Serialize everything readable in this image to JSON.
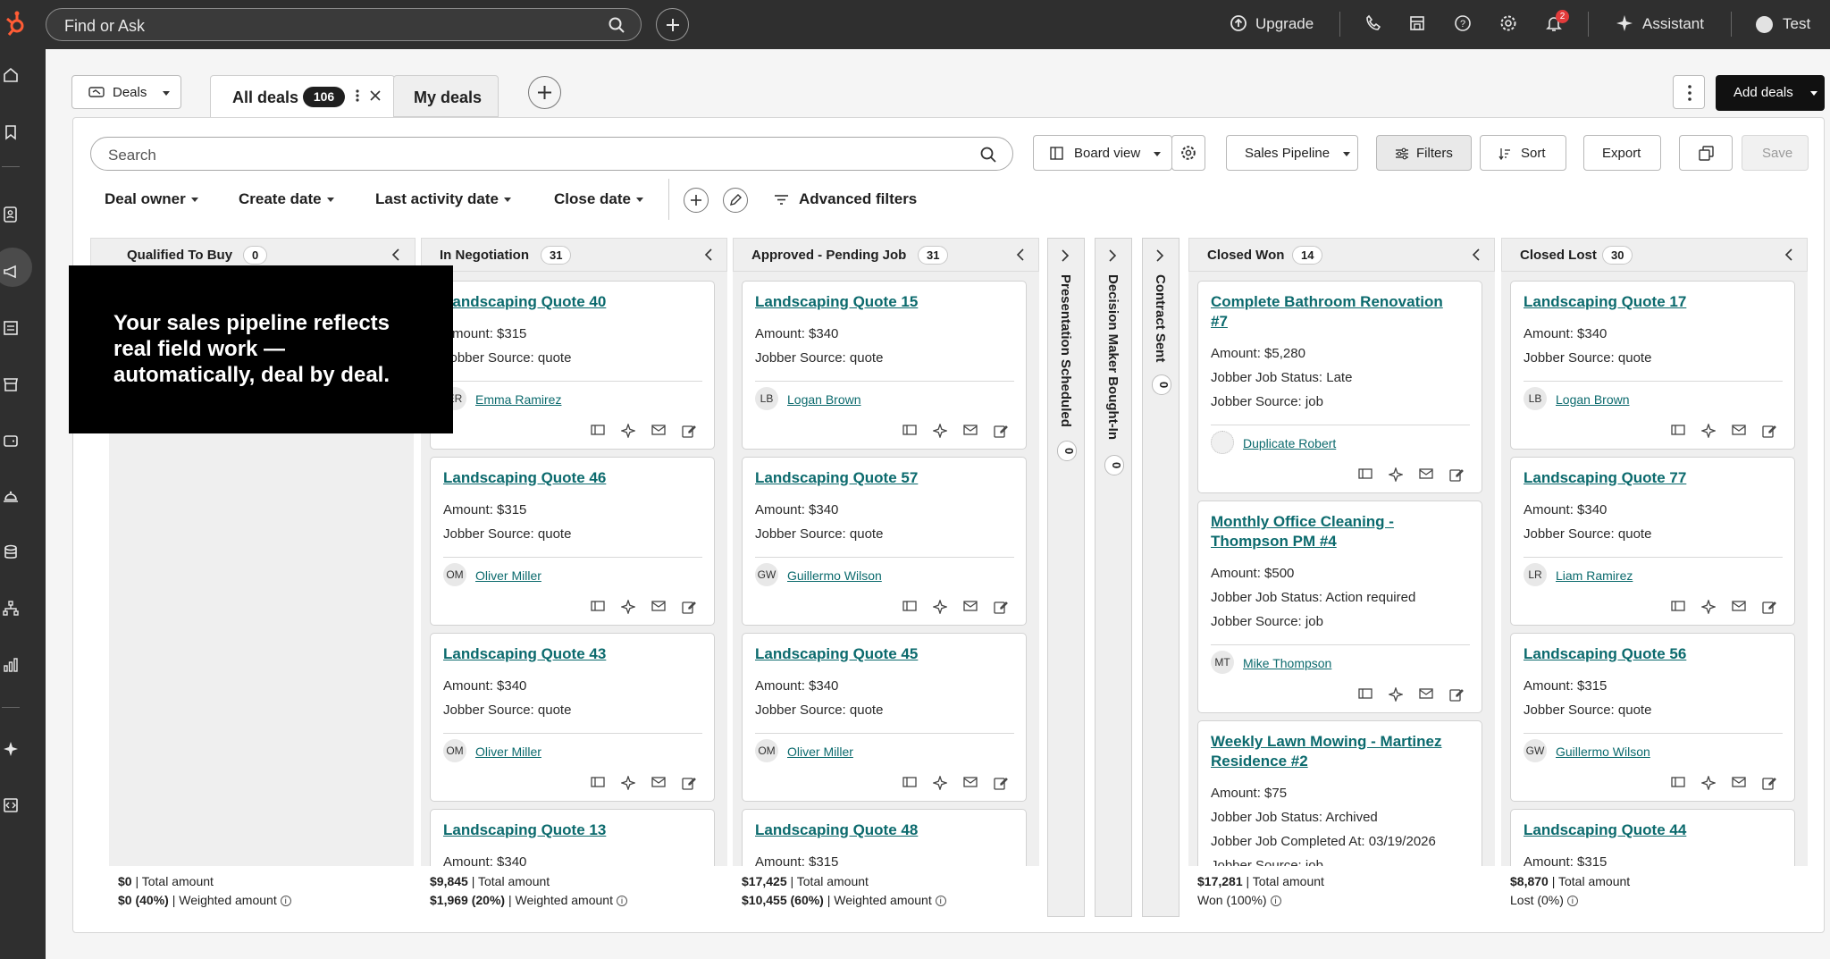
{
  "topbar": {
    "search_placeholder": "Find or Ask",
    "upgrade": "Upgrade",
    "notifications_count": "2",
    "assistant": "Assistant",
    "user": "Test"
  },
  "header": {
    "object_selector": "Deals",
    "tabs": [
      {
        "label": "All deals",
        "count": "106"
      },
      {
        "label": "My deals"
      }
    ],
    "add_deals": "Add deals"
  },
  "toolbar": {
    "search_placeholder": "Search",
    "board_view": "Board view",
    "pipeline": "Sales Pipeline",
    "filters": "Filters",
    "sort": "Sort",
    "export": "Export",
    "save": "Save"
  },
  "filters": {
    "deal_owner": "Deal owner",
    "create_date": "Create date",
    "last_activity_date": "Last activity date",
    "close_date": "Close date",
    "advanced": "Advanced filters"
  },
  "overlay": {
    "text": "Your sales pipeline reflects real field work — automatically, deal by deal."
  },
  "columns": [
    {
      "title": "Qualified To Buy",
      "count": "0",
      "total": "$0",
      "total_label": " | Total amount",
      "weighted": "$0 (40%)",
      "weighted_label": " | Weighted amount",
      "cards": []
    },
    {
      "title": "In Negotiation",
      "count": "31",
      "total": "$9,845",
      "total_label": " | Total amount",
      "weighted": "$1,969 (20%)",
      "weighted_label": " | Weighted amount",
      "cards": [
        {
          "title": "Landscaping Quote 40",
          "rows": [
            "Amount: $315",
            "Jobber Source: quote"
          ],
          "initials": "ER",
          "owner": "Emma Ramirez"
        },
        {
          "title": "Landscaping Quote 46",
          "rows": [
            "Amount: $315",
            "Jobber Source: quote"
          ],
          "initials": "OM",
          "owner": "Oliver Miller"
        },
        {
          "title": "Landscaping Quote 43",
          "rows": [
            "Amount: $340",
            "Jobber Source: quote"
          ],
          "initials": "OM",
          "owner": "Oliver Miller"
        },
        {
          "title": "Landscaping Quote 13",
          "rows": [
            "Amount: $340"
          ],
          "initials": "",
          "owner": ""
        }
      ]
    },
    {
      "title": "Approved - Pending Job",
      "count": "31",
      "total": "$17,425",
      "total_label": " | Total amount",
      "weighted": "$10,455 (60%)",
      "weighted_label": " | Weighted amount",
      "cards": [
        {
          "title": "Landscaping Quote 15",
          "rows": [
            "Amount: $340",
            "Jobber Source: quote"
          ],
          "initials": "LB",
          "owner": "Logan Brown"
        },
        {
          "title": "Landscaping Quote 57",
          "rows": [
            "Amount: $340",
            "Jobber Source: quote"
          ],
          "initials": "GW",
          "owner": "Guillermo Wilson"
        },
        {
          "title": "Landscaping Quote 45",
          "rows": [
            "Amount: $340",
            "Jobber Source: quote"
          ],
          "initials": "OM",
          "owner": "Oliver Miller"
        },
        {
          "title": "Landscaping Quote 48",
          "rows": [
            "Amount: $315"
          ],
          "initials": "",
          "owner": ""
        }
      ]
    },
    {
      "title": "Presentation Scheduled",
      "count": "0"
    },
    {
      "title": "Decision Maker Bought-In",
      "count": "0"
    },
    {
      "title": "Contract Sent",
      "count": "0"
    },
    {
      "title": "Closed Won",
      "count": "14",
      "total": "$17,281",
      "total_label": " | Total amount",
      "weighted": "Won (100%)",
      "weighted_label": "",
      "cards": [
        {
          "title": "Complete Bathroom Renovation #7",
          "rows": [
            "Amount: $5,280",
            "Jobber Job Status: Late",
            "Jobber Source: job"
          ],
          "initials": "",
          "owner": "Duplicate Robert"
        },
        {
          "title": "Monthly Office Cleaning - Thompson PM #4",
          "rows": [
            "Amount: $500",
            "Jobber Job Status: Action required",
            "Jobber Source: job"
          ],
          "initials": "MT",
          "owner": "Mike Thompson"
        },
        {
          "title": "Weekly Lawn Mowing - Martinez Residence #2",
          "rows": [
            "Amount: $75",
            "Jobber Job Status: Archived",
            "Jobber Job Completed At: 03/19/2026",
            "Jobber Source: job"
          ],
          "initials": "",
          "owner": ""
        }
      ]
    },
    {
      "title": "Closed Lost",
      "count": "30",
      "total": "$8,870",
      "total_label": " | Total amount",
      "weighted": "Lost (0%)",
      "weighted_label": "",
      "cards": [
        {
          "title": "Landscaping Quote 17",
          "rows": [
            "Amount: $340",
            "Jobber Source: quote"
          ],
          "initials": "LB",
          "owner": "Logan Brown"
        },
        {
          "title": "Landscaping Quote 77",
          "rows": [
            "Amount: $340",
            "Jobber Source: quote"
          ],
          "initials": "LR",
          "owner": "Liam Ramirez"
        },
        {
          "title": "Landscaping Quote 56",
          "rows": [
            "Amount: $315",
            "Jobber Source: quote"
          ],
          "initials": "GW",
          "owner": "Guillermo Wilson"
        },
        {
          "title": "Landscaping Quote 44",
          "rows": [
            "Amount: $315"
          ],
          "initials": "",
          "owner": ""
        }
      ]
    }
  ]
}
